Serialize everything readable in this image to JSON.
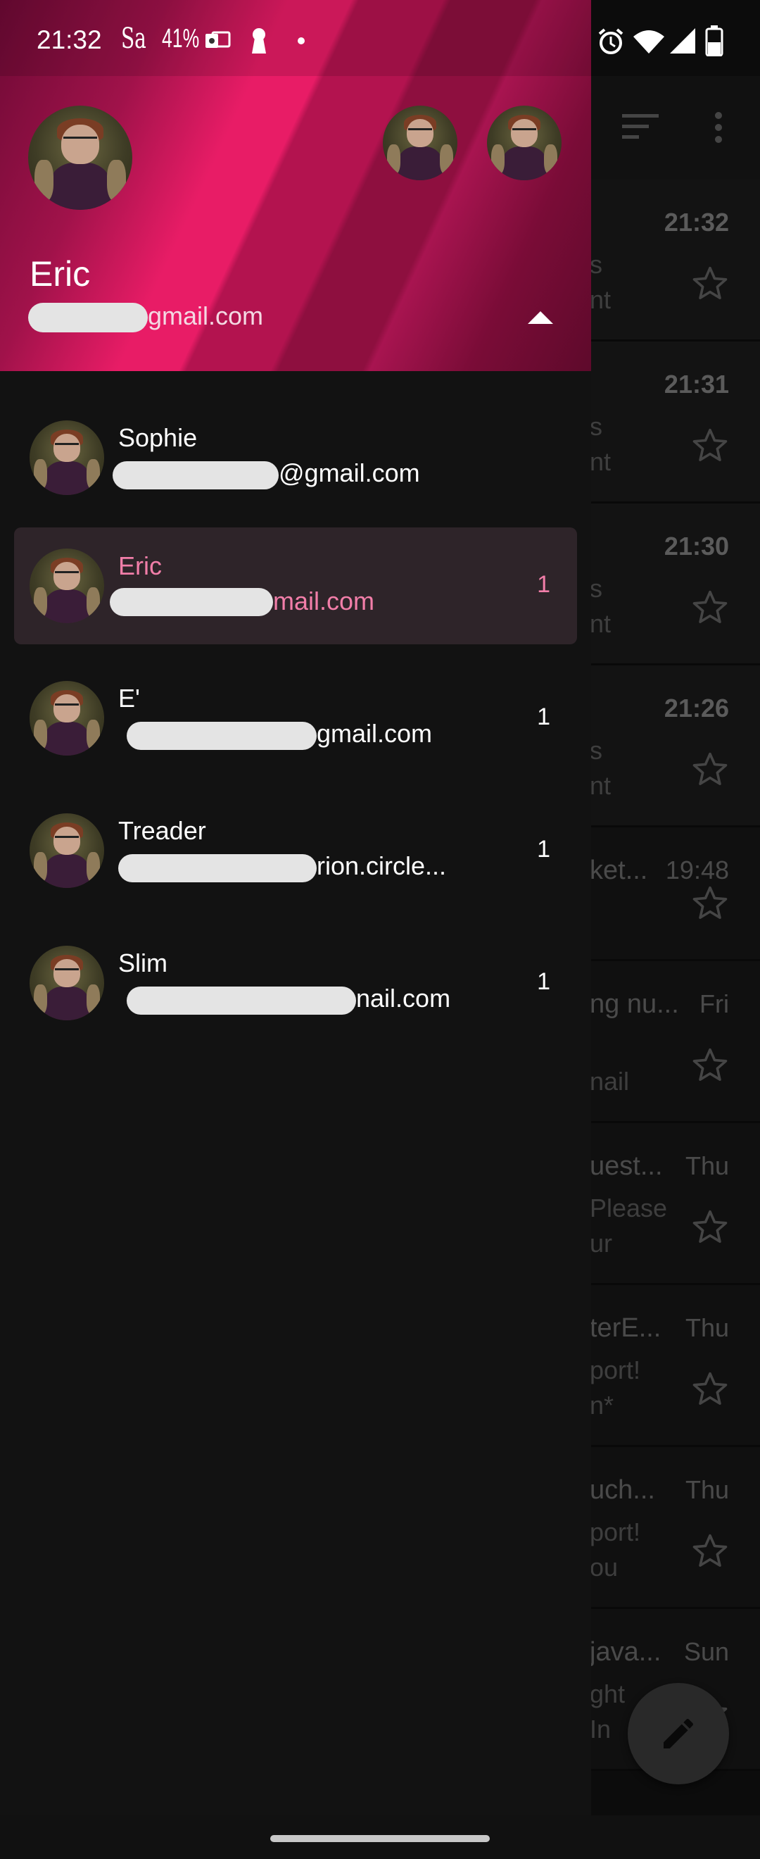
{
  "status_bar": {
    "time": "21:32",
    "carrier_glyph": "Sa",
    "battery_percent": "41%",
    "icons": [
      "outlook-icon",
      "keyhole-icon",
      "dot-icon",
      "alarm-icon",
      "wifi-icon",
      "signal-icon",
      "battery-icon"
    ]
  },
  "drawer": {
    "header": {
      "name": "Eric",
      "email": "gmail.com",
      "accent_color": "#e81c66"
    },
    "accounts": [
      {
        "name": "Sophie",
        "email": "@gmail.com",
        "count": "",
        "selected": false
      },
      {
        "name": "Eric",
        "email": "mail.com",
        "count": "1",
        "selected": true
      },
      {
        "name": "E'",
        "email": "gmail.com",
        "count": "1",
        "selected": false
      },
      {
        "name": "Treader",
        "email": "rion.circle...",
        "count": "1",
        "selected": false
      },
      {
        "name": "Slim",
        "email": "nail.com",
        "count": "1",
        "selected": false
      }
    ]
  },
  "email_list": {
    "rows": [
      {
        "subject": "",
        "preview_1": "s",
        "preview_2": "nt",
        "time": "21:32",
        "unread": true
      },
      {
        "subject": "",
        "preview_1": "s",
        "preview_2": "nt",
        "time": "21:31",
        "unread": true
      },
      {
        "subject": "",
        "preview_1": "s",
        "preview_2": "nt",
        "time": "21:30",
        "unread": true
      },
      {
        "subject": "",
        "preview_1": "s",
        "preview_2": "nt",
        "time": "21:26",
        "unread": true
      },
      {
        "subject": "ket...",
        "preview_1": "",
        "preview_2": "",
        "time": "19:48",
        "unread": false
      },
      {
        "subject": "ng nu...",
        "preview_1": "",
        "preview_2": "nail",
        "time": "Fri",
        "unread": false
      },
      {
        "subject": "uest...",
        "preview_1": "Please",
        "preview_2": "ur",
        "time": "Thu",
        "unread": false
      },
      {
        "subject": "terE...",
        "preview_1": "port!",
        "preview_2": "n*",
        "time": "Thu",
        "unread": false
      },
      {
        "subject": "uch...",
        "preview_1": "port!",
        "preview_2": "ou",
        "time": "Thu",
        "unread": false
      },
      {
        "subject": "java...",
        "preview_1": "ght",
        "preview_2": "In",
        "time": "Sun",
        "unread": false
      }
    ]
  }
}
